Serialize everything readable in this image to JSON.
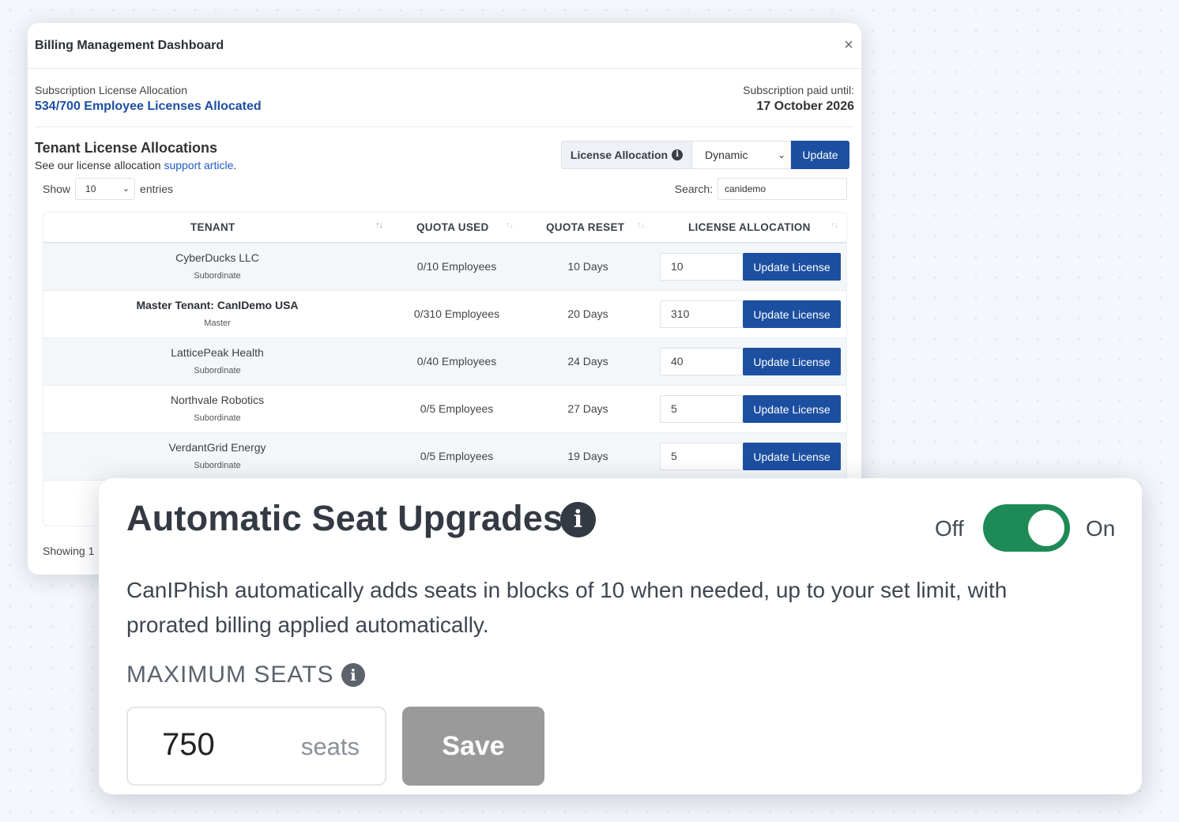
{
  "modal": {
    "title": "Billing Management Dashboard",
    "close_glyph": "×",
    "summary_label": "Subscription License Allocation",
    "summary_value": "534/700 Employee Licenses Allocated",
    "paid_label": "Subscription paid until:",
    "paid_value": "17 October 2026"
  },
  "tenant_section": {
    "title": "Tenant License Allocations",
    "sub_prefix": "See our license allocation ",
    "sub_link": "support article",
    "sub_suffix": ".",
    "allocation_label": "License Allocation",
    "allocation_mode": "Dynamic",
    "update_label": "Update"
  },
  "table_controls": {
    "show_label": "Show",
    "page_size": "10",
    "entries_label": "entries",
    "search_label": "Search:",
    "search_value": "canidemo"
  },
  "table": {
    "headers": {
      "tenant": "TENANT",
      "quota_used": "QUOTA USED",
      "quota_reset": "QUOTA RESET",
      "license_allocation": "LICENSE ALLOCATION"
    },
    "sort_glyph": "↑↓",
    "button_label": "Update License",
    "rows": [
      {
        "name": "CyberDucks LLC",
        "role": "Subordinate",
        "quota": "0/10 Employees",
        "reset": "10 Days",
        "allocation": "10"
      },
      {
        "name": "Master Tenant: CanIDemo USA",
        "role": "Master",
        "quota": "0/310 Employees",
        "reset": "20 Days",
        "allocation": "310"
      },
      {
        "name": "LatticePeak Health",
        "role": "Subordinate",
        "quota": "0/40 Employees",
        "reset": "24 Days",
        "allocation": "40"
      },
      {
        "name": "Northvale Robotics",
        "role": "Subordinate",
        "quota": "0/5 Employees",
        "reset": "27 Days",
        "allocation": "5"
      },
      {
        "name": "VerdantGrid Energy",
        "role": "Subordinate",
        "quota": "0/5 Employees",
        "reset": "19 Days",
        "allocation": "5"
      }
    ],
    "showing_text": "Showing 1"
  },
  "seat_card": {
    "title": "Automatic Seat Upgrades",
    "toggle_off_label": "Off",
    "toggle_on_label": "On",
    "toggle_state": "on",
    "description": "CanIPhish automatically adds seats in blocks of 10 when needed, up to your set limit, with prorated billing applied automatically.",
    "max_label": "MAXIMUM SEATS",
    "max_value": "750",
    "max_unit": "seats",
    "save_label": "Save"
  },
  "icons": {
    "info": "info-icon",
    "close": "close-icon",
    "chevron": "chevron-down-icon",
    "sort": "sort-icon"
  },
  "colors": {
    "primary_blue": "#1c4fa0",
    "link_blue": "#1e5bc6",
    "toggle_green": "#1e8a55",
    "save_disabled": "#9a9a9a"
  }
}
